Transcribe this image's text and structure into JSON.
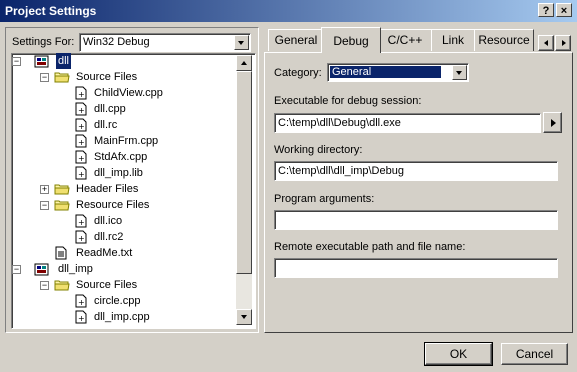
{
  "window": {
    "title": "Project Settings"
  },
  "settings_for": {
    "label": "Settings For:",
    "value": "Win32 Debug"
  },
  "tree": [
    {
      "label": "dll",
      "level": 0,
      "type": "project",
      "expander": "−",
      "selected": true
    },
    {
      "label": "Source Files",
      "level": 1,
      "type": "folder",
      "expander": "−"
    },
    {
      "label": "ChildView.cpp",
      "level": 2,
      "type": "file"
    },
    {
      "label": "dll.cpp",
      "level": 2,
      "type": "file"
    },
    {
      "label": "dll.rc",
      "level": 2,
      "type": "file"
    },
    {
      "label": "MainFrm.cpp",
      "level": 2,
      "type": "file"
    },
    {
      "label": "StdAfx.cpp",
      "level": 2,
      "type": "file"
    },
    {
      "label": "dll_imp.lib",
      "level": 2,
      "type": "file"
    },
    {
      "label": "Header Files",
      "level": 1,
      "type": "folder",
      "expander": "+"
    },
    {
      "label": "Resource Files",
      "level": 1,
      "type": "folder",
      "expander": "−"
    },
    {
      "label": "dll.ico",
      "level": 2,
      "type": "file"
    },
    {
      "label": "dll.rc2",
      "level": 2,
      "type": "file"
    },
    {
      "label": "ReadMe.txt",
      "level": 1,
      "type": "doc"
    },
    {
      "label": "dll_imp",
      "level": 0,
      "type": "project",
      "expander": "−"
    },
    {
      "label": "Source Files",
      "level": 1,
      "type": "folder",
      "expander": "−"
    },
    {
      "label": "circle.cpp",
      "level": 2,
      "type": "file"
    },
    {
      "label": "dll_imp.cpp",
      "level": 2,
      "type": "file"
    }
  ],
  "tabs": [
    {
      "label": "General",
      "active": false
    },
    {
      "label": "Debug",
      "active": true
    },
    {
      "label": "C/C++",
      "active": false
    },
    {
      "label": "Link",
      "active": false
    },
    {
      "label": "Resource",
      "active": false
    }
  ],
  "debug": {
    "category_label": "Category:",
    "category_value": "General",
    "exe_label": "Executable for debug session:",
    "exe_value": "C:\\temp\\dll\\Debug\\dll.exe",
    "workdir_label": "Working directory:",
    "workdir_value": "C:\\temp\\dll\\dll_imp\\Debug",
    "args_label": "Program arguments:",
    "args_value": "",
    "remote_label": "Remote executable path and file name:",
    "remote_value": ""
  },
  "buttons": {
    "ok": "OK",
    "cancel": "Cancel"
  },
  "colors": {
    "title_start": "#0a246a",
    "title_end": "#a6caf0",
    "face": "#d4d0c8",
    "selection": "#0a246a"
  }
}
